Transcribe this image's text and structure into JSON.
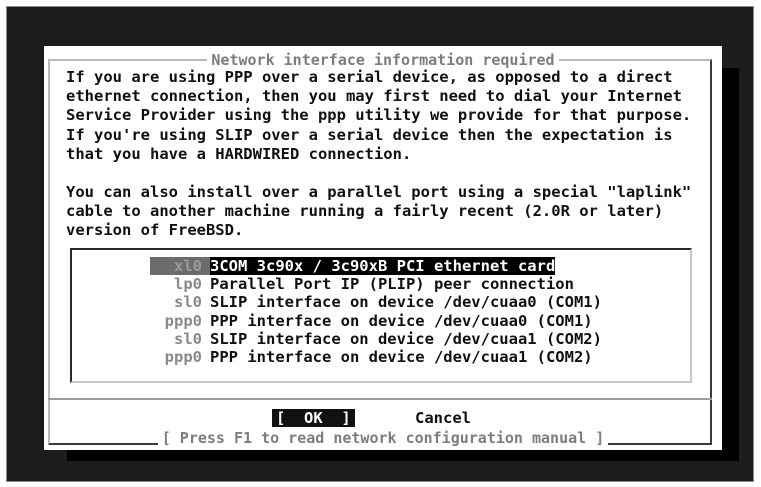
{
  "dialog": {
    "title": "Network interface information required",
    "paragraphs": [
      "If you are using PPP over a serial device, as opposed to a direct",
      "ethernet connection, then you may first need to dial your Internet",
      "Service Provider using the ppp utility we provide for that purpose.",
      "If you're using SLIP over a serial device then the expectation is",
      "that you have a HARDWIRED connection.",
      "You can also install over a parallel port using a special \"laplink\"",
      "cable to another machine running a fairly recent (2.0R or later)",
      "version of FreeBSD."
    ],
    "menu": [
      {
        "tag": "xl0",
        "desc": "3COM 3c90x / 3c90xB PCI ethernet card",
        "selected": true
      },
      {
        "tag": "lp0",
        "desc": "Parallel Port IP (PLIP) peer connection",
        "selected": false
      },
      {
        "tag": "sl0",
        "desc": "SLIP interface on device /dev/cuaa0 (COM1)",
        "selected": false
      },
      {
        "tag": "ppp0",
        "desc": "PPP interface on device /dev/cuaa0 (COM1)",
        "selected": false
      },
      {
        "tag": "sl0",
        "desc": "SLIP interface on device /dev/cuaa1 (COM2)",
        "selected": false
      },
      {
        "tag": "ppp0",
        "desc": "PPP interface on device /dev/cuaa1 (COM2)",
        "selected": false
      }
    ],
    "ok_label": "[  OK  ]",
    "cancel_label": "Cancel",
    "footer": "[ Press F1 to read network configuration manual ]"
  }
}
